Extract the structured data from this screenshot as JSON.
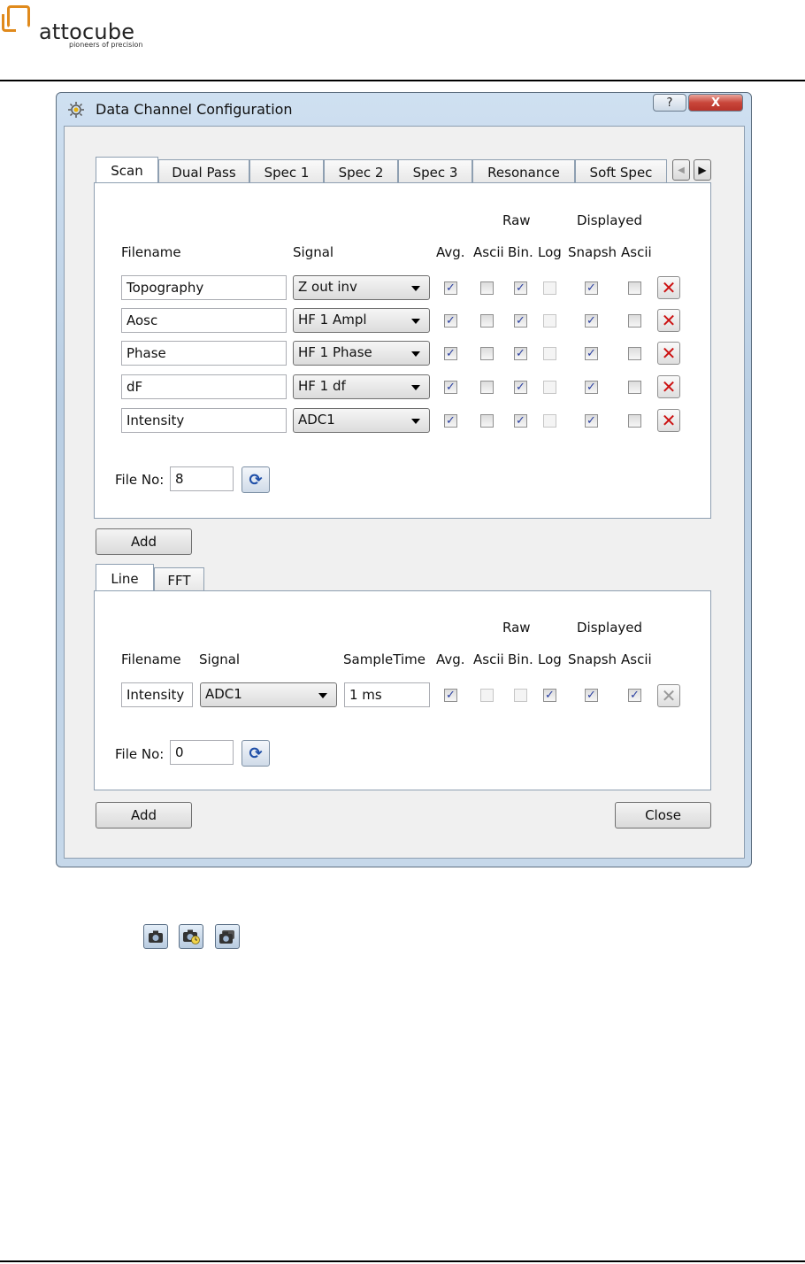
{
  "brand": {
    "name": "attocube",
    "tagline": "pioneers of precision",
    "color": "#e08a1c"
  },
  "window": {
    "title": "Data Channel Configuration",
    "help_label": "?",
    "close_label": "X"
  },
  "scan_tabs": [
    "Scan",
    "Dual Pass",
    "Spec 1",
    "Spec 2",
    "Spec 3",
    "Resonance",
    "Soft Spec"
  ],
  "scan_tab_active": "Scan",
  "headers": {
    "raw": "Raw",
    "displayed": "Displayed",
    "filename": "Filename",
    "signal": "Signal",
    "sample_time": "SampleTime",
    "avg": "Avg.",
    "ascii": "Ascii",
    "bin": "Bin.",
    "log": "Log",
    "snapsh": "Snapsh",
    "ascii2": "Ascii"
  },
  "scan_rows": [
    {
      "filename": "Topography",
      "signal": "Z out inv",
      "avg": true,
      "ascii": false,
      "bin": true,
      "log": false,
      "snapsh": true,
      "ascii2": false
    },
    {
      "filename": "Aosc",
      "signal": "HF 1 Ampl",
      "avg": true,
      "ascii": false,
      "bin": true,
      "log": false,
      "snapsh": true,
      "ascii2": false
    },
    {
      "filename": "Phase",
      "signal": "HF 1 Phase",
      "avg": true,
      "ascii": false,
      "bin": true,
      "log": false,
      "snapsh": true,
      "ascii2": false
    },
    {
      "filename": "dF",
      "signal": "HF 1 df",
      "avg": true,
      "ascii": false,
      "bin": true,
      "log": false,
      "snapsh": true,
      "ascii2": false
    },
    {
      "filename": "Intensity",
      "signal": "ADC1",
      "avg": true,
      "ascii": false,
      "bin": true,
      "log": false,
      "snapsh": true,
      "ascii2": false
    }
  ],
  "file_no_label": "File No:",
  "scan_file_no": "8",
  "add_label": "Add",
  "close_button_label": "Close",
  "line_tabs": [
    "Line",
    "FFT"
  ],
  "line_tab_active": "Line",
  "line_rows": [
    {
      "filename": "Intensity",
      "signal": "ADC1",
      "sample_time": "1 ms",
      "avg": true,
      "ascii": false,
      "bin": false,
      "log": true,
      "snapsh": true,
      "ascii2": true
    }
  ],
  "line_file_no": "0",
  "check_glyph": "✓",
  "icons": [
    "snapshot-camera-icon",
    "timed-snapshot-camera-icon",
    "multi-snapshot-camera-icon"
  ]
}
